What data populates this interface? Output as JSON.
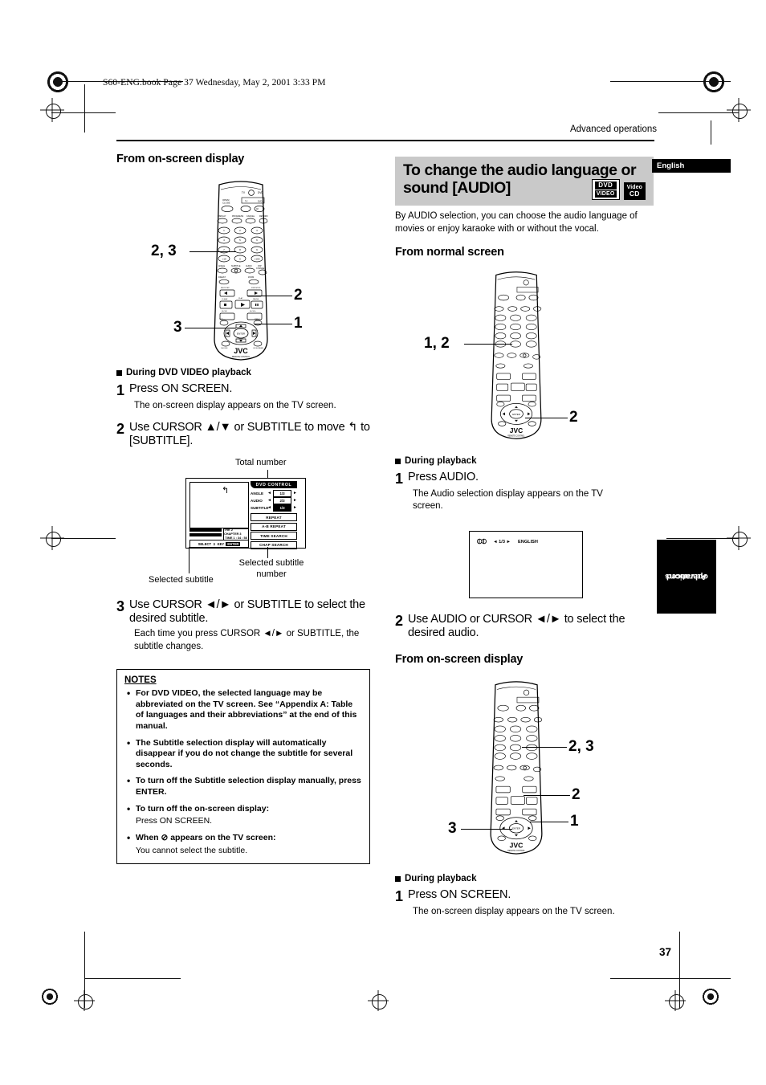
{
  "printmarks": {
    "book_line": "S60-ENG.book  Page 37  Wednesday, May 2, 2001  3:33 PM"
  },
  "header": {
    "running_head": "Advanced operations"
  },
  "left_column": {
    "heading": "From on-screen display",
    "remote_callouts": [
      "2, 3",
      "2",
      "3",
      "1"
    ],
    "playback_note": "During DVD VIDEO playback",
    "steps": [
      {
        "num": "1",
        "text": "Press ON SCREEN.",
        "desc": "The on-screen display appears on the TV screen."
      },
      {
        "num": "2",
        "text": "Use CURSOR ▲/▼ or SUBTITLE to move ↰ to [SUBTITLE].",
        "desc": ""
      },
      {
        "num": "3",
        "text": "Use CURSOR ◄/► or SUBTITLE to select the desired subtitle.",
        "desc": "Each time you press CURSOR ◄/► or SUBTITLE, the subtitle changes."
      }
    ],
    "osd": {
      "caption_total": "Total number",
      "caption_selected_number": "Selected subtitle number",
      "caption_selected": "Selected subtitle",
      "panel_title": "DVD CONTROL",
      "rows": [
        {
          "label": "ANGLE",
          "value": "1/3"
        },
        {
          "label": "AUDIO",
          "value": "2/3"
        },
        {
          "label": "SUBTITLE",
          "value": "1/3"
        }
      ],
      "buttons": [
        "REPEAT",
        "A-B REPEAT",
        "TIME SEARCH",
        "CHAP SEARCH"
      ],
      "info_chapter": "TRK 2  CHAPTER 3",
      "info_time": "TIME  1 : 34 : 58",
      "select_bar": "SELECT",
      "select_key": "KEY",
      "select_enter": "ENTER"
    },
    "notes": {
      "title": "NOTES",
      "items": [
        {
          "bold": "For DVD VIDEO, the selected language may be abbreviated on the TV screen.  See “Appendix A: Table of languages and their abbreviations” at the end of this manual.",
          "plain": ""
        },
        {
          "bold": "The Subtitle selection display will automatically disappear if you do not change the subtitle for several seconds.",
          "plain": ""
        },
        {
          "bold": "To turn off the Subtitle selection display manually, press ENTER.",
          "plain": ""
        },
        {
          "bold": "To turn off the on-screen display:",
          "plain": "Press ON SCREEN."
        },
        {
          "bold": "When ⊘ appears on the TV screen:",
          "plain": "You cannot select the subtitle."
        }
      ]
    }
  },
  "right_column": {
    "banner_title": "To change the audio language or sound [AUDIO]",
    "language_tag": "English",
    "logos": [
      {
        "line1": "DVD",
        "line2": "VIDEO"
      },
      {
        "line1": "Video",
        "line2": "CD"
      }
    ],
    "lead": "By AUDIO selection, you can choose the audio language of movies or enjoy karaoke with or without the vocal.",
    "section1": {
      "heading": "From normal screen",
      "remote_callouts": [
        "1, 2",
        "2"
      ],
      "playback_note": "During playback",
      "steps": [
        {
          "num": "1",
          "text": "Press AUDIO.",
          "desc": "The Audio selection display appears on the TV screen."
        },
        {
          "num": "2",
          "text": "Use AUDIO or CURSOR ◄/► to select the desired audio.",
          "desc": ""
        }
      ],
      "audio_display": {
        "icon": "audio-channel-icon",
        "counter": "1/3",
        "language": "ENGLISH"
      }
    },
    "section2": {
      "heading": "From on-screen display",
      "remote_callouts": [
        "2, 3",
        "2",
        "3",
        "1"
      ],
      "playback_note": "During playback",
      "steps": [
        {
          "num": "1",
          "text": "Press ON SCREEN.",
          "desc": "The on-screen display appears on the TV screen."
        }
      ]
    }
  },
  "side_tab": {
    "line1": "Advanced",
    "line2": "operations"
  },
  "page_number": "37",
  "remote": {
    "brand": "JVC",
    "brand_sub": "REMOTE CONTROL",
    "top_labels": [
      "TV",
      "DVD"
    ],
    "open_close": "OPEN/CLOSE",
    "standby": "STANDBY/ON",
    "fn_row": [
      "DISPLAY",
      "PROGRESS",
      "CANCEL",
      "RETURN"
    ],
    "mid_row": [
      "ANGLE",
      "SUBTITLE",
      "AUDIO",
      "VFP CHANGE"
    ],
    "row2": [
      "DIGEST",
      "ZOOM"
    ],
    "enter": "ENTER"
  }
}
